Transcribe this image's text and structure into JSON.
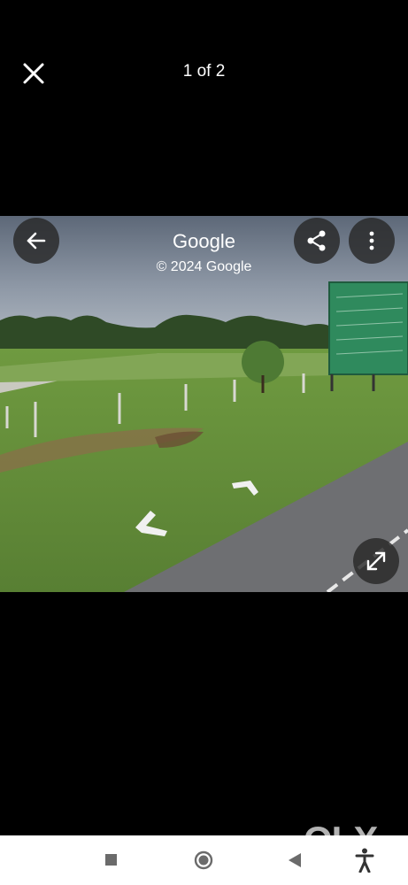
{
  "viewer": {
    "counter": "1 of 2",
    "close_icon": "close-icon"
  },
  "streetview": {
    "brand": "Google",
    "copyright": "© 2024 Google",
    "back_icon": "arrow-left-icon",
    "share_icon": "share-icon",
    "more_icon": "more-vert-icon",
    "expand_icon": "expand-icon"
  },
  "watermark": "OLX",
  "nav": {
    "recents_icon": "square-icon",
    "home_icon": "circle-icon",
    "back_icon": "triangle-back-icon",
    "accessibility_icon": "accessibility-icon"
  }
}
